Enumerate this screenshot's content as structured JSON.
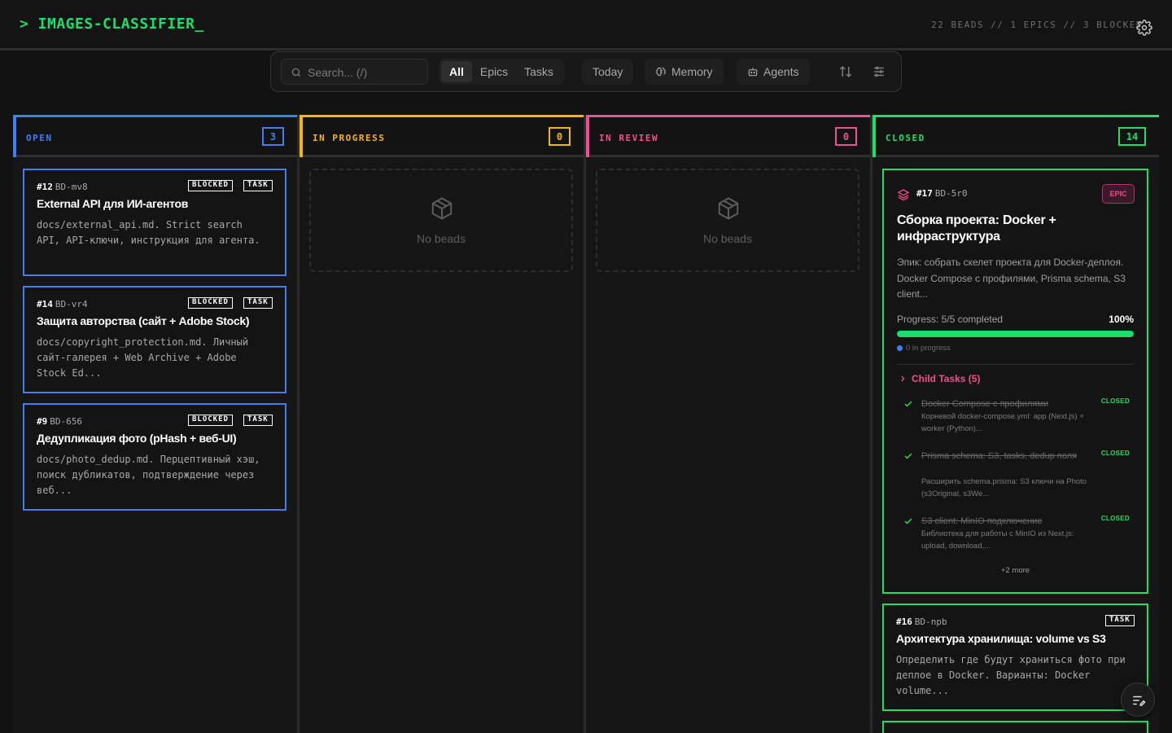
{
  "app": {
    "title": "> IMAGES-CLASSIFIER_",
    "stats": "22 BEADS // 1 EPICS // 3 BLOCKED",
    "accent": "#19e06a"
  },
  "toolbar": {
    "search_placeholder": "Search... (/)",
    "filters": [
      "All",
      "Epics",
      "Tasks"
    ],
    "active_filter": "All",
    "today_label": "Today",
    "memory_label": "Memory",
    "agents_label": "Agents"
  },
  "columns": {
    "open": {
      "title": "OPEN",
      "count": "3",
      "color": "#3f7ef5"
    },
    "in_progress": {
      "title": "IN PROGRESS",
      "count": "0",
      "color": "#f5b800",
      "empty_text": "No beads"
    },
    "in_review": {
      "title": "IN REVIEW",
      "count": "0",
      "color": "#f0508e",
      "empty_text": "No beads"
    },
    "closed": {
      "title": "CLOSED",
      "count": "14",
      "color": "#19e06a"
    }
  },
  "open_cards": [
    {
      "num": "#12",
      "code": "BD-mv8",
      "tags": [
        "BLOCKED",
        "TASK"
      ],
      "title": "External API для ИИ-агентов",
      "desc": "docs/external_api.md. Strict search API, API-ключи, инструкция для агента."
    },
    {
      "num": "#14",
      "code": "BD-vr4",
      "tags": [
        "BLOCKED",
        "TASK"
      ],
      "title": "Защита авторства (сайт + Adobe Stock)",
      "desc": "docs/copyright_protection.md. Личный сайт-галерея + Web Archive + Adobe Stock Ed..."
    },
    {
      "num": "#9",
      "code": "BD-656",
      "tags": [
        "BLOCKED",
        "TASK"
      ],
      "title": "Дедупликация фото (pHash + веб-UI)",
      "desc": "docs/photo_dedup.md. Перцептивный хэш, поиск дубликатов, подтверждение через веб..."
    }
  ],
  "epic": {
    "num": "#17",
    "code": "BD-5r0",
    "badge": "EPIC",
    "title": "Сборка проекта: Docker + инфраструктура",
    "desc": "Эпик: собрать скелет проекта для Docker-деплоя. Docker Compose с профилями, Prisma schema, S3 client...",
    "progress_label": "Progress: 5/5 completed",
    "progress_pct_label": "100%",
    "progress_fraction": 1.0,
    "in_progress_label": "0 in progress",
    "children_label": "Child Tasks (5)",
    "children": [
      {
        "title": "Docker Compose с профилями",
        "status": "CLOSED",
        "desc": "Корневой docker-compose.yml: app (Next.js) + worker (Python)..."
      },
      {
        "title": "Prisma schema: S3, tasks, dedup поля",
        "status": "CLOSED",
        "desc": "Расширить schema.prisma: S3 ключи на Photo (s3Original, s3We..."
      },
      {
        "title": "S3 client: MinIO подключение",
        "status": "CLOSED",
        "desc": "Библиотека для работы с MinIO из Next.js: upload, download,..."
      }
    ],
    "more_label": "+2 more"
  },
  "closed_task": {
    "num": "#16",
    "code": "BD-npb",
    "tag": "TASK",
    "title": "Архитектура хранилища: volume vs S3",
    "desc": "Определить где будут храниться фото при деплое в Docker. Варианты: Docker volume..."
  }
}
